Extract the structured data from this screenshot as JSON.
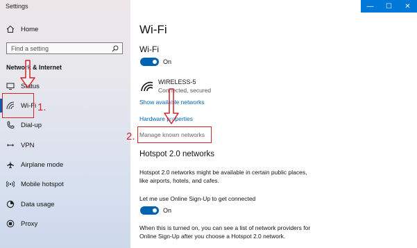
{
  "window": {
    "title": "Settings",
    "buttons": {
      "minimize": "—",
      "maximize": "☐",
      "close": "✕"
    }
  },
  "sidebar": {
    "home_label": "Home",
    "search_placeholder": "Find a setting",
    "section_title": "Network & Internet",
    "items": [
      {
        "label": "Status",
        "icon": "status-icon"
      },
      {
        "label": "Wi-Fi",
        "icon": "wifi-icon",
        "selected": true
      },
      {
        "label": "Dial-up",
        "icon": "dialup-icon"
      },
      {
        "label": "VPN",
        "icon": "vpn-icon"
      },
      {
        "label": "Airplane mode",
        "icon": "airplane-icon"
      },
      {
        "label": "Mobile hotspot",
        "icon": "hotspot-icon"
      },
      {
        "label": "Data usage",
        "icon": "data-usage-icon"
      },
      {
        "label": "Proxy",
        "icon": "proxy-icon"
      }
    ]
  },
  "main": {
    "page_title": "Wi-Fi",
    "wifi_section_title": "Wi-Fi",
    "wifi_toggle_label": "On",
    "network": {
      "name": "WIRELESS-5",
      "status": "Connected, secured"
    },
    "links": {
      "show_available": "Show available networks",
      "hardware_properties": "Hardware properties",
      "manage_known": "Manage known networks"
    },
    "hotspot": {
      "title": "Hotspot 2.0 networks",
      "description_line1": "Hotspot 2.0 networks might be available in certain public places,",
      "description_line2": "like airports, hotels, and cafes.",
      "signup_label": "Let me use Online Sign-Up to get connected",
      "signup_toggle_label": "On",
      "footer_line1": "When this is turned on, you can see a list of network providers for",
      "footer_line2": "Online Sign-Up after you choose a Hotspot 2.0 network."
    }
  },
  "annotations": {
    "step1": "1.",
    "step2": "2."
  },
  "colors": {
    "accent": "#0063b1",
    "titlebar": "#0078d7",
    "annotation": "#d4232a"
  }
}
